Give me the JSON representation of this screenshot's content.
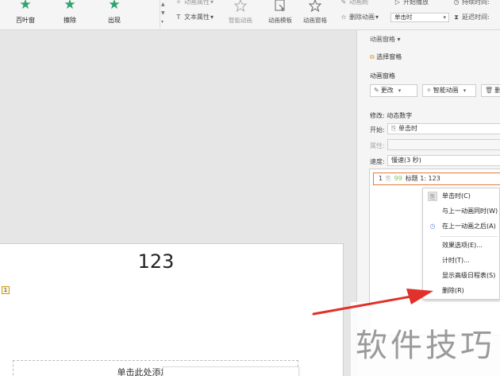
{
  "ribbon": {
    "effects": [
      {
        "label": "百叶窗",
        "icon": "star-icon"
      },
      {
        "label": "擦除",
        "icon": "star-icon"
      },
      {
        "label": "出现",
        "icon": "star-icon"
      }
    ],
    "anim_props": "动画属性",
    "text_props": "文本属性",
    "smart_anim": "智能动画",
    "anim_template": "动画模板",
    "anim_pane": "动画窗格",
    "delete_anim": "删除动画",
    "anim_brush": "动画刷",
    "start_play": "开始播放",
    "trigger_value": "单击时",
    "duration_label": "持续时间:",
    "delay_label": "延迟时间:"
  },
  "slide": {
    "title": "123",
    "marker": "1",
    "subtitle_placeholder": "单击此处添加副标题"
  },
  "pane": {
    "title": "动画窗格",
    "select_pane": "选择窗格",
    "section_title": "动画窗格",
    "change_btn": "更改",
    "smart_anim_btn": "智能动画",
    "delete_btn": "删",
    "modify": "修改: 动态数字",
    "start_label": "开始:",
    "start_value": "单击时",
    "property_label": "属性:",
    "speed_label": "速度:",
    "speed_value": "慢速(3 秒)",
    "item_number": "1",
    "item_text": "标题 1: 123"
  },
  "context_menu": {
    "items": [
      {
        "label": "单击时(C)",
        "icon": "mouse-icon",
        "selected": true
      },
      {
        "label": "与上一动画同时(W)",
        "icon": "",
        "selected": false
      },
      {
        "label": "在上一动画之后(A)",
        "icon": "clock-icon",
        "selected": false
      },
      {
        "label": "效果选项(E)...",
        "icon": "",
        "selected": false
      },
      {
        "label": "计时(T)...",
        "icon": "",
        "selected": false
      },
      {
        "label": "显示高级日程表(S)",
        "icon": "",
        "selected": false
      },
      {
        "label": "删除(R)",
        "icon": "",
        "selected": false
      }
    ]
  },
  "watermark": "软件技巧",
  "colors": {
    "accent_green": "#2ea36a",
    "arrow_red": "#e0312b",
    "item_border": "#e77a3a"
  }
}
